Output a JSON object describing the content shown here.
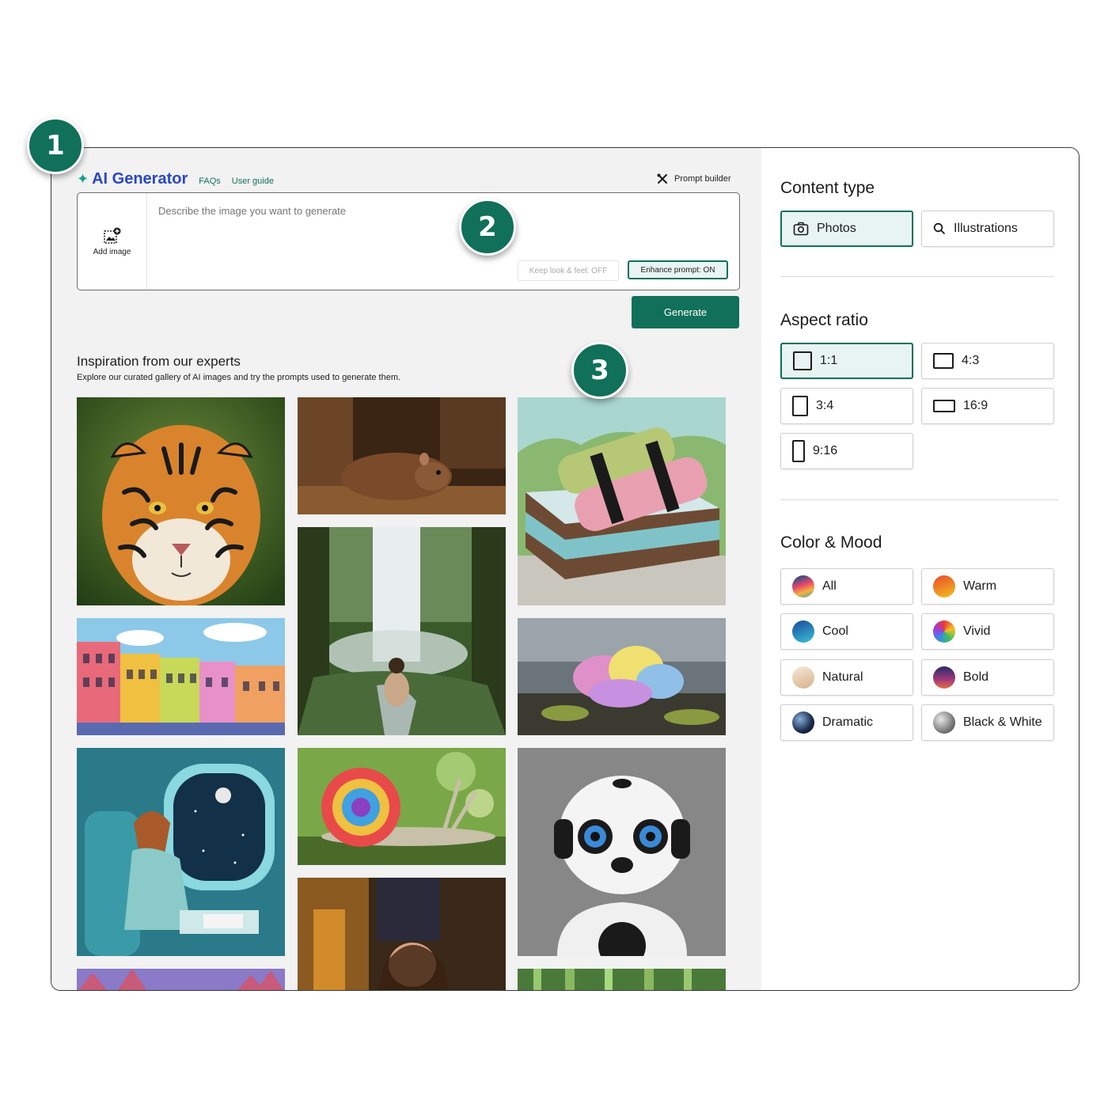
{
  "callouts": [
    "1",
    "2",
    "3"
  ],
  "header": {
    "app_title": "AI Generator",
    "faqs": "FAQs",
    "user_guide": "User guide",
    "prompt_builder": "Prompt builder"
  },
  "prompt": {
    "add_image": "Add image",
    "placeholder": "Describe the image you want to generate",
    "keep_look": "Keep look & feel: OFF",
    "enhance": "Enhance prompt: ON",
    "generate": "Generate"
  },
  "inspiration": {
    "title": "Inspiration from our experts",
    "subtitle": "Explore our curated gallery of AI images and try the prompts used to generate them."
  },
  "gallery": [
    {
      "icon": "tiger-photo"
    },
    {
      "icon": "hamster-photo"
    },
    {
      "icon": "sushi-illustration"
    },
    {
      "icon": "colorful-buildings-illustration"
    },
    {
      "icon": "waterfall-photo"
    },
    {
      "icon": "colored-smoke-photo"
    },
    {
      "icon": "airplane-window-illustration"
    },
    {
      "icon": "rainbow-snail-photo"
    },
    {
      "icon": "robot-photo"
    },
    {
      "icon": "forest-illustration"
    },
    {
      "icon": "girl-reading-photo"
    },
    {
      "icon": "bamboo-photo"
    }
  ],
  "content_type": {
    "title": "Content type",
    "options": [
      {
        "label": "Photos",
        "icon": "camera-icon",
        "selected": true
      },
      {
        "label": "Illustrations",
        "icon": "search-icon",
        "selected": false
      }
    ]
  },
  "aspect_ratio": {
    "title": "Aspect ratio",
    "options": [
      {
        "label": "1:1",
        "selected": true
      },
      {
        "label": "4:3",
        "selected": false
      },
      {
        "label": "3:4",
        "selected": false
      },
      {
        "label": "16:9",
        "selected": false
      },
      {
        "label": "9:16",
        "selected": false
      }
    ]
  },
  "color_mood": {
    "title": "Color & Mood",
    "options": [
      {
        "label": "All",
        "color": "#e8703a"
      },
      {
        "label": "Warm",
        "color": "#f5a623"
      },
      {
        "label": "Cool",
        "color": "#2f86c9"
      },
      {
        "label": "Vivid",
        "color": "#8a3fd1"
      },
      {
        "label": "Natural",
        "color": "#e6c9a8"
      },
      {
        "label": "Bold",
        "color": "#5a2a7a"
      },
      {
        "label": "Dramatic",
        "color": "#2a3c5c"
      },
      {
        "label": "Black & White",
        "color": "#8a8a8a"
      }
    ]
  },
  "colors": {
    "accent": "#10705a",
    "brand": "#2a47c9"
  }
}
